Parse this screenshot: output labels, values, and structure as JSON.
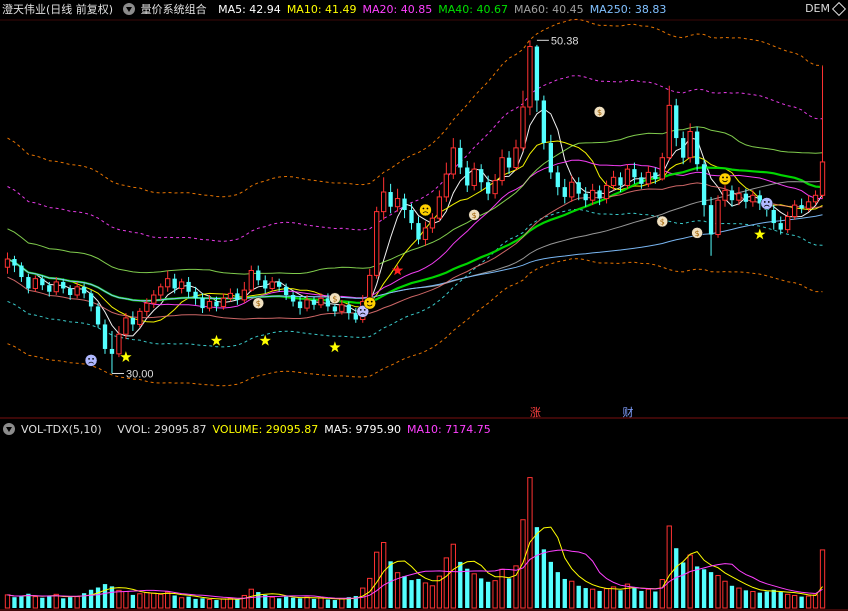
{
  "header": {
    "stock_name": "澄天伟业(日线 前复权)",
    "indicator_name": "量价系统组合",
    "ma_values": [
      {
        "label": "MA5: 42.94",
        "color": "#ffffff"
      },
      {
        "label": "MA10: 41.49",
        "color": "#ffff00"
      },
      {
        "label": "MA20: 40.85",
        "color": "#ff40ff"
      },
      {
        "label": "MA40: 40.67",
        "color": "#00e000"
      },
      {
        "label": "MA60: 40.45",
        "color": "#a0a0a0"
      },
      {
        "label": "MA250: 38.83",
        "color": "#80c0ff"
      }
    ],
    "demo_label": "DEM"
  },
  "volume_header": {
    "indicator": "VOL-TDX(5,10)",
    "values": [
      {
        "label": "VVOL: 29095.87",
        "color": "#dddddd"
      },
      {
        "label": "VOLUME: 29095.87",
        "color": "#ffff00"
      },
      {
        "label": "MA5: 9795.90",
        "color": "#ffffff"
      },
      {
        "label": "MA10: 7174.75",
        "color": "#ff40ff"
      }
    ]
  },
  "markers": {
    "up_label": "涨",
    "finance_label": "财"
  },
  "chart_data": {
    "type": "candlestick",
    "price_high_label": "50.38",
    "price_low_label": "30.00",
    "price_range": [
      28.5,
      51.5
    ],
    "volume_range": [
      0,
      29500
    ],
    "colors": {
      "up": "#ff3232",
      "down": "#54ffff"
    },
    "candles": [
      [
        36.5,
        37.0,
        37.4,
        36.1,
        2300
      ],
      [
        37.0,
        36.6,
        37.2,
        36.2,
        1900
      ],
      [
        36.6,
        35.9,
        36.8,
        35.6,
        2100
      ],
      [
        35.9,
        35.2,
        36.1,
        34.9,
        2500
      ],
      [
        35.2,
        35.8,
        36.0,
        35.0,
        2000
      ],
      [
        35.8,
        35.4,
        36.0,
        35.1,
        1800
      ],
      [
        35.4,
        35.0,
        35.6,
        34.7,
        2200
      ],
      [
        35.0,
        35.6,
        35.9,
        34.8,
        2400
      ],
      [
        35.6,
        35.2,
        35.8,
        34.9,
        1700
      ],
      [
        35.2,
        34.8,
        35.4,
        34.5,
        1900
      ],
      [
        34.8,
        35.3,
        35.6,
        34.6,
        2000
      ],
      [
        35.3,
        34.9,
        35.5,
        34.6,
        2600
      ],
      [
        34.9,
        34.1,
        35.1,
        33.8,
        3200
      ],
      [
        34.1,
        33.0,
        34.3,
        32.8,
        3600
      ],
      [
        33.0,
        31.5,
        33.3,
        31.2,
        4200
      ],
      [
        31.5,
        31.2,
        32.6,
        30.0,
        3800
      ],
      [
        31.2,
        32.4,
        32.9,
        31.0,
        3100
      ],
      [
        32.4,
        33.4,
        33.7,
        32.1,
        2900
      ],
      [
        33.4,
        33.0,
        33.8,
        32.6,
        2300
      ],
      [
        33.0,
        33.8,
        34.0,
        32.8,
        2500
      ],
      [
        33.8,
        34.3,
        34.6,
        33.5,
        2700
      ],
      [
        34.3,
        34.8,
        35.1,
        34.0,
        2600
      ],
      [
        34.8,
        35.3,
        35.5,
        34.5,
        2400
      ],
      [
        35.3,
        35.8,
        36.3,
        35.0,
        2800
      ],
      [
        35.8,
        35.2,
        36.1,
        34.9,
        2200
      ],
      [
        35.2,
        35.6,
        35.8,
        34.9,
        1800
      ],
      [
        35.6,
        35.0,
        35.9,
        34.6,
        2000
      ],
      [
        35.0,
        34.6,
        35.3,
        34.2,
        1600
      ],
      [
        34.6,
        34.0,
        34.9,
        33.7,
        1700
      ],
      [
        34.0,
        34.4,
        34.8,
        33.8,
        1500
      ],
      [
        34.4,
        34.1,
        34.7,
        33.8,
        1400
      ],
      [
        34.1,
        34.6,
        34.9,
        33.9,
        1600
      ],
      [
        34.6,
        34.9,
        35.2,
        34.4,
        1700
      ],
      [
        34.9,
        34.5,
        35.2,
        34.2,
        1500
      ],
      [
        34.5,
        35.1,
        35.6,
        34.3,
        2200
      ],
      [
        35.1,
        36.3,
        36.6,
        35.0,
        3300
      ],
      [
        36.3,
        35.7,
        36.6,
        35.4,
        2800
      ],
      [
        35.7,
        35.2,
        36.0,
        34.9,
        2300
      ],
      [
        35.2,
        35.6,
        35.9,
        35.0,
        1900
      ],
      [
        35.6,
        35.3,
        35.8,
        35.0,
        1700
      ],
      [
        35.3,
        34.8,
        35.5,
        34.5,
        2000
      ],
      [
        34.8,
        34.4,
        35.0,
        34.1,
        1800
      ],
      [
        34.4,
        34.0,
        34.7,
        33.6,
        1700
      ],
      [
        34.0,
        34.5,
        34.8,
        33.8,
        1900
      ],
      [
        34.5,
        34.2,
        34.7,
        33.9,
        1600
      ],
      [
        34.2,
        34.6,
        34.9,
        34.0,
        1800
      ],
      [
        34.6,
        34.1,
        34.9,
        33.8,
        1500
      ],
      [
        34.1,
        33.8,
        34.4,
        33.5,
        1400
      ],
      [
        33.8,
        34.2,
        34.5,
        33.6,
        1600
      ],
      [
        34.2,
        33.7,
        34.4,
        33.3,
        1900
      ],
      [
        33.7,
        33.3,
        34.0,
        33.1,
        2100
      ],
      [
        33.3,
        34.4,
        34.8,
        33.1,
        3500
      ],
      [
        34.4,
        36.0,
        36.4,
        34.2,
        5200
      ],
      [
        36.0,
        39.9,
        40.2,
        35.8,
        9800
      ],
      [
        39.9,
        41.1,
        42.0,
        39.4,
        11500
      ],
      [
        41.1,
        40.2,
        41.6,
        39.8,
        8200
      ],
      [
        40.2,
        40.7,
        41.3,
        39.9,
        6200
      ],
      [
        40.7,
        40.0,
        41.0,
        39.5,
        5600
      ],
      [
        40.0,
        39.2,
        40.4,
        38.8,
        4900
      ],
      [
        39.2,
        38.2,
        39.6,
        37.9,
        5100
      ],
      [
        38.2,
        38.9,
        39.3,
        37.8,
        4400
      ],
      [
        38.9,
        39.5,
        39.8,
        38.6,
        3900
      ],
      [
        39.5,
        40.8,
        41.2,
        39.3,
        5600
      ],
      [
        40.8,
        42.2,
        42.9,
        40.5,
        8800
      ],
      [
        42.2,
        43.8,
        44.4,
        41.9,
        11200
      ],
      [
        43.8,
        42.6,
        44.3,
        42.2,
        8100
      ],
      [
        42.6,
        41.5,
        43.0,
        41.1,
        6900
      ],
      [
        41.5,
        42.5,
        42.9,
        41.2,
        6000
      ],
      [
        42.5,
        41.7,
        42.8,
        41.2,
        5200
      ],
      [
        41.7,
        41.0,
        42.1,
        40.6,
        4600
      ],
      [
        41.0,
        41.8,
        42.2,
        40.7,
        4800
      ],
      [
        41.8,
        43.2,
        43.7,
        41.5,
        6800
      ],
      [
        43.2,
        42.6,
        43.6,
        42.2,
        5200
      ],
      [
        42.6,
        43.8,
        44.3,
        42.4,
        7400
      ],
      [
        43.8,
        46.3,
        47.3,
        43.6,
        15500
      ],
      [
        46.3,
        50.0,
        50.38,
        45.8,
        22900
      ],
      [
        50.0,
        46.7,
        50.1,
        46.0,
        14200
      ],
      [
        46.7,
        44.1,
        47.0,
        43.7,
        10300
      ],
      [
        44.1,
        42.3,
        44.6,
        41.9,
        8100
      ],
      [
        42.3,
        41.4,
        42.7,
        40.9,
        6300
      ],
      [
        41.4,
        40.8,
        41.9,
        40.4,
        5100
      ],
      [
        40.8,
        41.7,
        42.1,
        40.5,
        4700
      ],
      [
        41.7,
        41.0,
        42.0,
        40.6,
        3900
      ],
      [
        41.0,
        40.6,
        41.4,
        40.2,
        3500
      ],
      [
        40.6,
        41.2,
        41.6,
        40.3,
        3300
      ],
      [
        41.2,
        40.7,
        41.5,
        40.3,
        3000
      ],
      [
        40.7,
        41.5,
        41.8,
        40.4,
        3400
      ],
      [
        41.5,
        42.0,
        42.4,
        41.2,
        3700
      ],
      [
        42.0,
        41.5,
        42.3,
        41.1,
        3100
      ],
      [
        41.5,
        42.5,
        42.8,
        41.3,
        4200
      ],
      [
        42.5,
        42.0,
        42.9,
        41.6,
        3500
      ],
      [
        42.0,
        41.6,
        42.3,
        41.3,
        3000
      ],
      [
        41.6,
        42.3,
        42.7,
        41.4,
        3300
      ],
      [
        42.3,
        41.9,
        42.6,
        41.6,
        2900
      ],
      [
        41.9,
        43.2,
        43.5,
        41.8,
        5000
      ],
      [
        43.2,
        46.4,
        47.6,
        43.0,
        14400
      ],
      [
        46.4,
        44.4,
        46.8,
        43.9,
        10500
      ],
      [
        44.4,
        43.2,
        44.8,
        42.8,
        8000
      ],
      [
        43.2,
        44.8,
        45.3,
        42.9,
        9300
      ],
      [
        44.8,
        42.8,
        45.1,
        42.4,
        7300
      ],
      [
        42.8,
        40.3,
        43.1,
        39.6,
        6800
      ],
      [
        40.3,
        38.5,
        40.8,
        37.2,
        6300
      ],
      [
        38.5,
        40.6,
        40.9,
        38.3,
        5700
      ],
      [
        40.6,
        41.2,
        41.6,
        40.2,
        4700
      ],
      [
        41.2,
        40.6,
        41.5,
        40.2,
        3900
      ],
      [
        40.6,
        41.0,
        41.4,
        40.3,
        3500
      ],
      [
        41.0,
        40.5,
        41.3,
        40.1,
        3100
      ],
      [
        40.5,
        40.9,
        41.2,
        40.2,
        2900
      ],
      [
        40.9,
        40.4,
        41.2,
        40.0,
        2700
      ],
      [
        40.4,
        40.0,
        40.7,
        39.6,
        2900
      ],
      [
        40.0,
        39.2,
        40.3,
        38.8,
        3200
      ],
      [
        39.2,
        38.8,
        39.6,
        38.5,
        2800
      ],
      [
        38.8,
        39.6,
        39.9,
        38.6,
        2400
      ],
      [
        39.6,
        40.3,
        40.6,
        39.4,
        2200
      ],
      [
        40.3,
        40.1,
        40.7,
        39.8,
        2000
      ],
      [
        40.1,
        40.5,
        40.9,
        39.9,
        2100
      ],
      [
        40.5,
        40.9,
        41.2,
        40.3,
        2300
      ],
      [
        40.9,
        42.94,
        48.8,
        40.7,
        10200
      ]
    ]
  }
}
